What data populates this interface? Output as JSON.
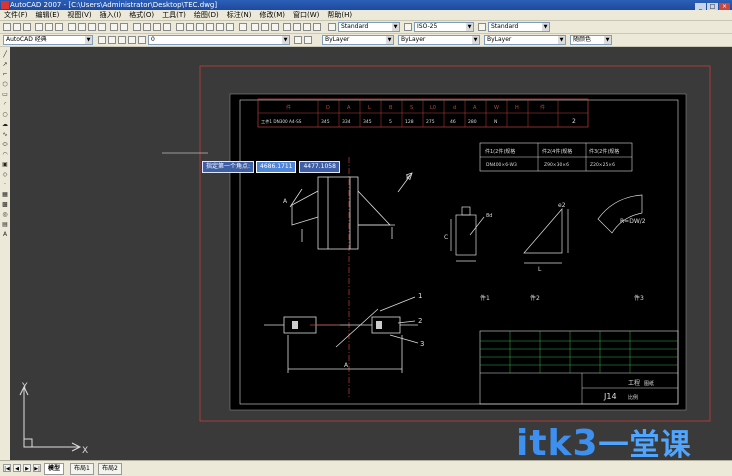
{
  "window": {
    "title": "AutoCAD 2007 - [C:\\Users\\Administrator\\Desktop\\TEC.dwg]",
    "buttons": [
      "_",
      "□",
      "×"
    ]
  },
  "menu": [
    "文件(F)",
    "编辑(E)",
    "视图(V)",
    "插入(I)",
    "格式(O)",
    "工具(T)",
    "绘图(D)",
    "标注(N)",
    "修改(M)",
    "窗口(W)",
    "帮助(H)"
  ],
  "toolbar1": {
    "text_style": "Standard",
    "dim_style": "ISO-25",
    "table_style": "Standard"
  },
  "toolbar2": {
    "workspace": "AutoCAD 经典",
    "layer": "0",
    "color": "ByLayer",
    "linetype": "ByLayer",
    "lineweight": "ByLayer",
    "plotstyle": "随颜色"
  },
  "tooltip": {
    "label": "指定第一个角点:",
    "x_value": "4686.1711",
    "y_value": "4477.1058"
  },
  "status": {
    "tabs": [
      "模型",
      "布局1",
      "布局2"
    ],
    "nav": [
      "|◀",
      "◀",
      "▶",
      "▶|"
    ]
  },
  "ucs": {
    "x_label": "X",
    "y_label": "Y"
  },
  "title_table": {
    "headers": [
      "件",
      "D",
      "A",
      "L",
      "B",
      "S",
      "L0",
      "d",
      "A",
      "W",
      "H",
      "件"
    ],
    "row": [
      "工件1 DN300 A4-SS",
      "345",
      "334",
      "345",
      "5",
      "128",
      "275",
      "46",
      "280",
      "N",
      "2"
    ]
  },
  "spec_box": {
    "headers": [
      "件1(2件)规格",
      "件2(4件)规格",
      "件3(2件)规格"
    ],
    "values": [
      "DN400×6-W3",
      "Z90×30×6",
      "Z20×25×6"
    ]
  },
  "drawing": {
    "part_labels": [
      "件1",
      "件2",
      "件3"
    ],
    "leader_labels": [
      "1",
      "2",
      "3"
    ],
    "dim_labels": [
      "K",
      "A",
      "A",
      "C",
      "8d",
      "L",
      "e2",
      "R=DW/2",
      "L"
    ]
  },
  "title_block": {
    "name": "工程",
    "drawing_no": "J14",
    "sub": "图纸",
    "scale": "比例"
  },
  "watermark": {
    "text": "itk3",
    "suffix": "一堂课"
  },
  "colors": {
    "canvas": "#3a3a3a",
    "paper": "#000000",
    "accent_red": "#c0403a",
    "green": "#37b24a",
    "title_blue": "#2c5fb8"
  }
}
